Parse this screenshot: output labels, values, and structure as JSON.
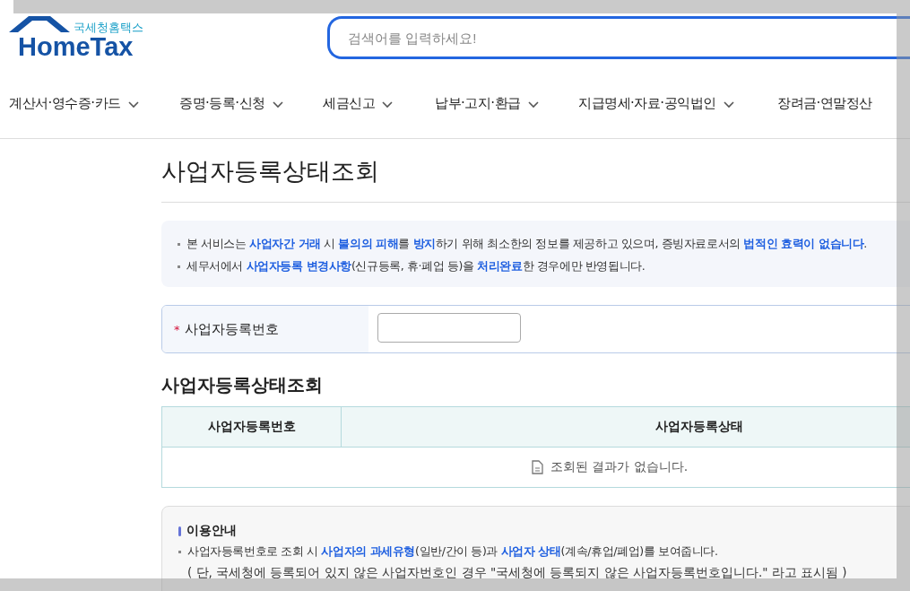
{
  "logo": {
    "subtitle": "국세청홈택스",
    "name": "HomeTax"
  },
  "search": {
    "placeholder": "검색어를 입력하세요!"
  },
  "nav": [
    "계산서·영수증·카드",
    "증명·등록·신청",
    "세금신고",
    "납부·고지·환급",
    "지급명세·자료·공익법인",
    "장려금·연말정산"
  ],
  "page_title": "사업자등록상태조회",
  "notices": [
    "본 서비스는 **사업자간 거래** 시 **불의의 피해**를 **방지**하기 위해 최소한의 정보를 제공하고 있으며, 증빙자료로서의 **법적인 효력이 없습니다**.",
    "세무서에서 **사업자등록 변경사항**(신규등록, 휴·폐업 등)을 **처리완료**한 경우에만 반영됩니다."
  ],
  "form": {
    "required_mark": "*",
    "label": "사업자등록번호"
  },
  "result": {
    "title": "사업자등록상태조회",
    "columns": [
      "사업자등록번호",
      "사업자등록상태"
    ],
    "empty_message": "조회된 결과가 없습니다."
  },
  "guide": {
    "title": "이용안내",
    "items": [
      {
        "kind": "bullet",
        "text": "사업자등록번호로 조회 시 **사업자의 과세유형**(일반/간이 등)과 **사업자 상태**(계속/휴업/폐업)를 보여줍니다."
      },
      {
        "kind": "note",
        "text": "( 단, 국세청에 등록되어 있지 않은 사업자번호인 경우 \"국세청에 등록되지 않은 사업자등록번호입니다.\" 라고 표시됨 )"
      }
    ]
  }
}
